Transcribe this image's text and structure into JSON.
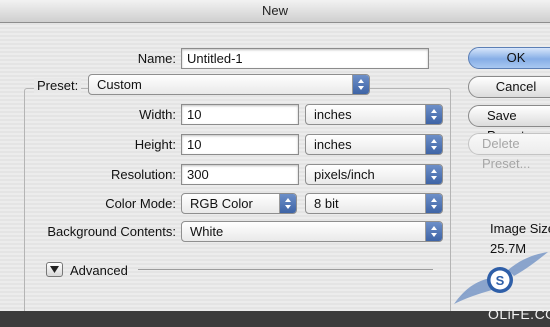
{
  "window": {
    "title": "New"
  },
  "form": {
    "name_label": "Name:",
    "name_value": "Untitled-1",
    "preset_label": "Preset:",
    "preset_value": "Custom",
    "width_label": "Width:",
    "width_value": "10",
    "width_unit": "inches",
    "height_label": "Height:",
    "height_value": "10",
    "height_unit": "inches",
    "resolution_label": "Resolution:",
    "resolution_value": "300",
    "resolution_unit": "pixels/inch",
    "color_mode_label": "Color Mode:",
    "color_mode_value": "RGB Color",
    "bit_depth_value": "8 bit",
    "background_label": "Background Contents:",
    "background_value": "White",
    "advanced_label": "Advanced"
  },
  "buttons": {
    "ok": "OK",
    "cancel": "Cancel",
    "save_preset": "Save Preset...",
    "delete_preset": "Delete Preset..."
  },
  "info": {
    "image_size_label": "Image Size:",
    "image_size_value": "25.7M"
  },
  "watermark": {
    "site": "OLiFE.COM",
    "logo_letter": "S"
  },
  "colors": {
    "accent": "#4a6fb0",
    "dialog_bg": "#e8e8e8",
    "titlebar": "#d9d9d9"
  },
  "icons": {
    "popup_arrows": "updown-arrows-icon",
    "advanced": "disclosure-triangle-icon"
  }
}
